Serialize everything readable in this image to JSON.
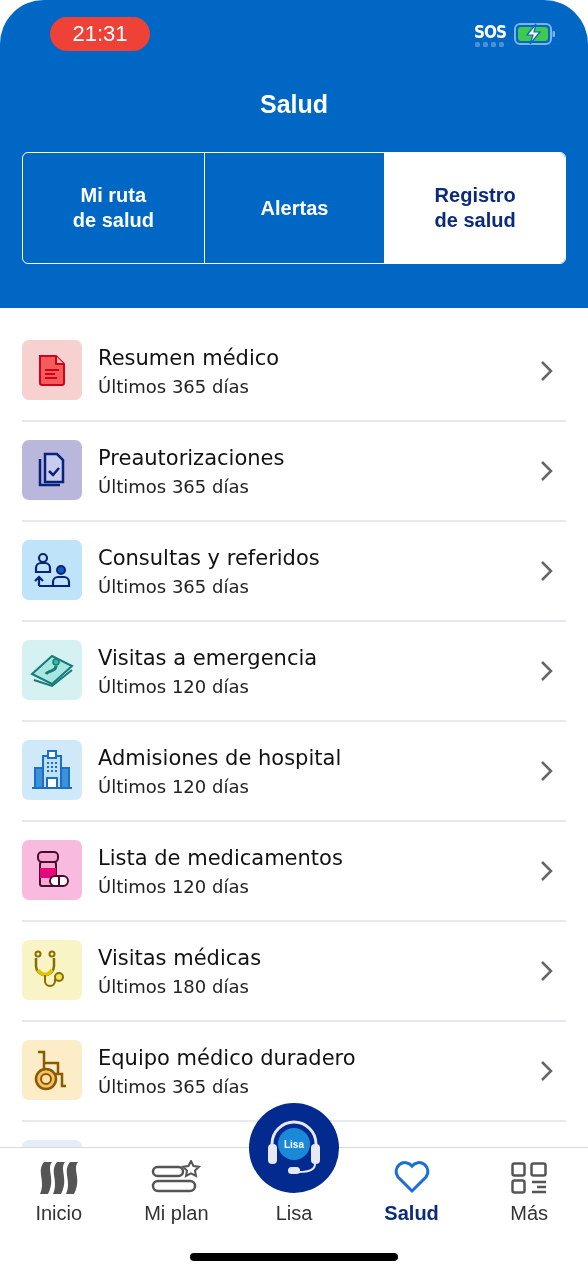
{
  "status_bar": {
    "time": "21:31",
    "sos": "SOS"
  },
  "header": {
    "title": "Salud"
  },
  "tabs": [
    {
      "label": "Mi ruta\nde salud",
      "selected": false
    },
    {
      "label": "Alertas",
      "selected": false
    },
    {
      "label": "Registro\nde salud",
      "selected": true
    }
  ],
  "records": [
    {
      "color": "#f7d0d0",
      "title": "Resumen médico",
      "subtitle": "Últimos 365 días"
    },
    {
      "color": "#b9b8dc",
      "title": "Preautorizaciones",
      "subtitle": "Últimos 365 días"
    },
    {
      "color": "#bfe3f8",
      "title": "Consultas y referidos",
      "subtitle": "Últimos 365 días"
    },
    {
      "color": "#d5f1f1",
      "title": "Visitas a emergencia",
      "subtitle": "Últimos 120 días"
    },
    {
      "color": "#cfe9f8",
      "title": "Admisiones de hospital",
      "subtitle": "Últimos 120 días"
    },
    {
      "color": "#f8bbdf",
      "title": "Lista de medicamentos",
      "subtitle": "Últimos 120 días"
    },
    {
      "color": "#f8f4c6",
      "title": "Visitas médicas",
      "subtitle": "Últimos 180 días"
    },
    {
      "color": "#fdecc8",
      "title": "Equipo médico duradero",
      "subtitle": "Últimos 365 días"
    },
    {
      "color": "#e3eef8"
    }
  ],
  "bottom_nav": [
    {
      "label": "Inicio",
      "selected": false
    },
    {
      "label": "Mi plan",
      "selected": false
    },
    {
      "kind": "assistant",
      "label": "Lisa",
      "badge": "Lisa",
      "selected": false
    },
    {
      "label": "Salud",
      "selected": true
    },
    {
      "label": "Más",
      "selected": false
    }
  ]
}
